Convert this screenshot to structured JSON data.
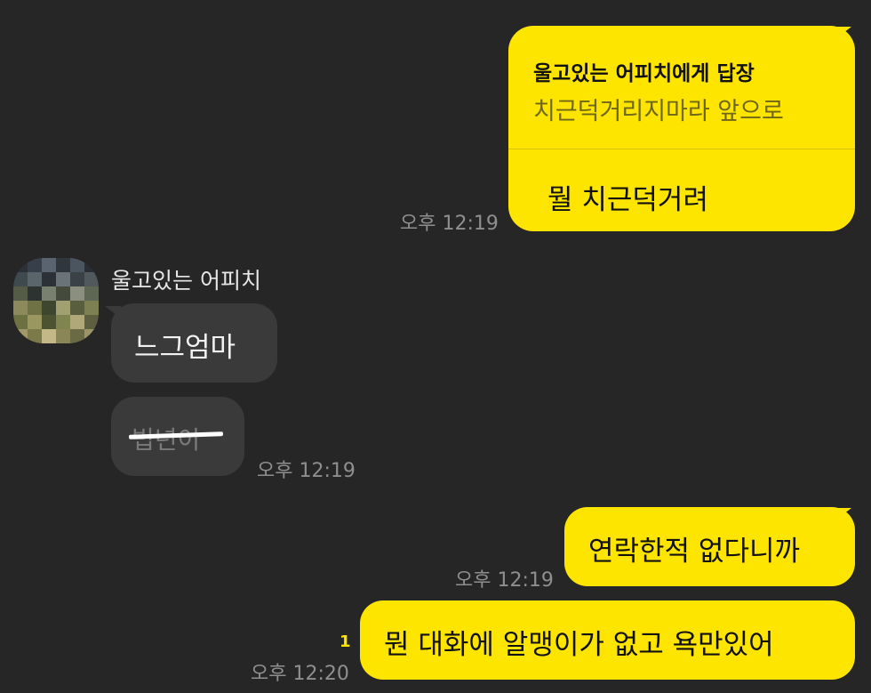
{
  "conversation": {
    "reply": {
      "title": "울고있는 어피치에게 답장",
      "quoted": "치근덕거리지마라 앞으로",
      "text": "뭘 치근덕거려",
      "time": "오후 12:19"
    },
    "incoming": {
      "sender": "울고있는 어피치",
      "avatar": "pixelated-avatar",
      "messages": [
        {
          "text": "느그엄마",
          "deleted": false
        },
        {
          "text": "빕년이",
          "deleted": true
        }
      ],
      "time": "오후 12:19"
    },
    "outgoing": [
      {
        "text": "연락한적 없다니까",
        "time": "오후 12:19"
      },
      {
        "text": "뭔 대화에 알맹이가 없고 욕만있어",
        "time": "오후 12:20",
        "unread": "1"
      }
    ]
  },
  "colors": {
    "background": "#262626",
    "my_bubble": "#fee500",
    "their_bubble": "#3a3a3a",
    "timestamp": "#8f8f8f"
  }
}
